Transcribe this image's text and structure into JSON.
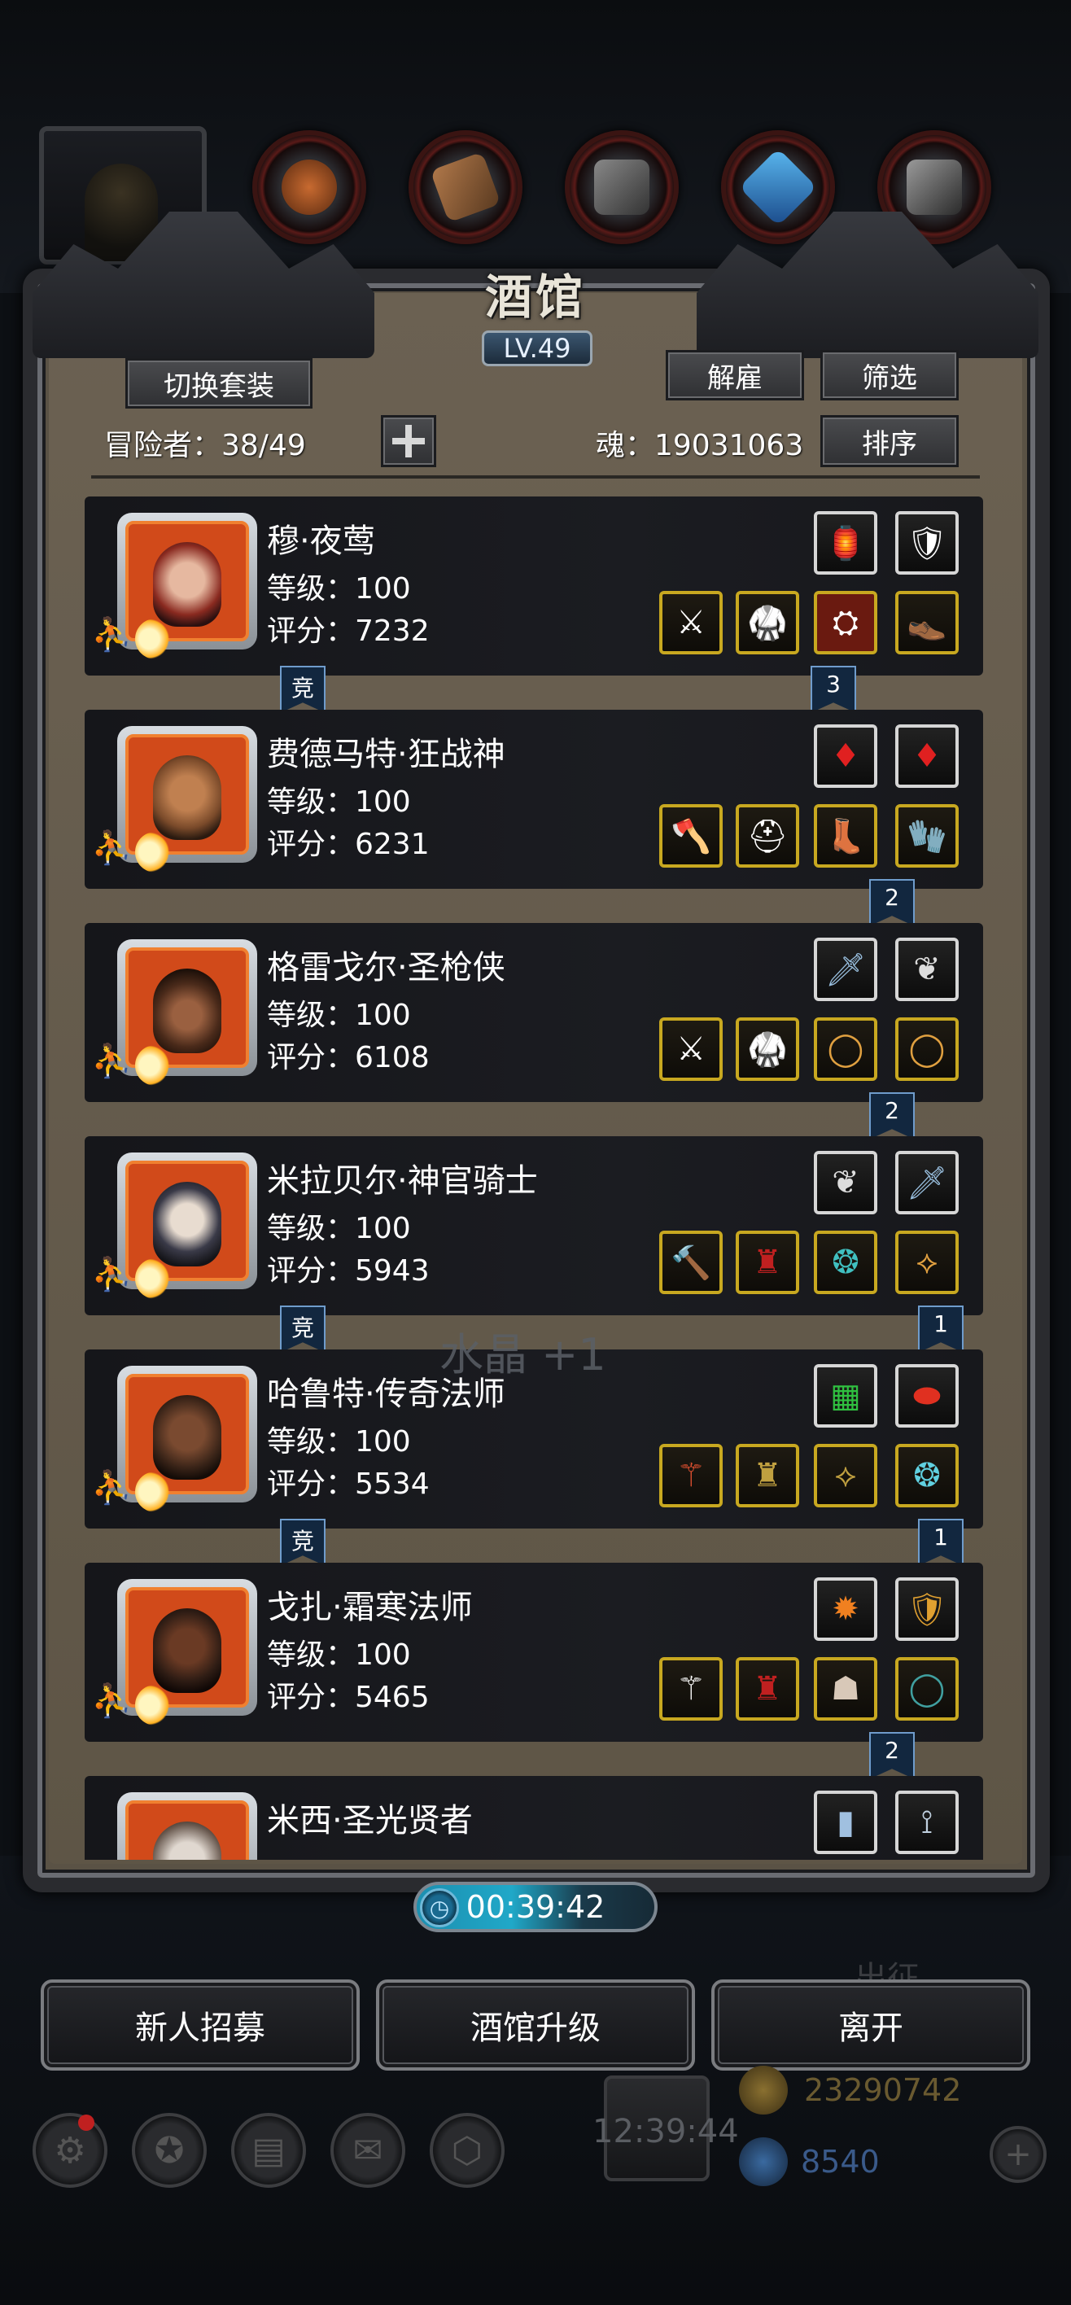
{
  "tavern": {
    "title": "酒馆",
    "level": "LV.49",
    "switch_outfit": "切换套装",
    "dismiss": "解雇",
    "filter": "筛选",
    "sort": "排序",
    "adventurers_label": "冒险者：38/49",
    "soul_label": "魂：19031063"
  },
  "heroes": [
    {
      "name": "穆·夜莺",
      "level": "等级：100",
      "score": "评分：7232",
      "ribbon_left": "竞",
      "ribbon_right": "3",
      "face": "#8a2a20"
    },
    {
      "name": "费德马特·狂战神",
      "level": "等级：100",
      "score": "评分：6231",
      "ribbon_left": "",
      "ribbon_right": "2",
      "face": "#7a4a2a"
    },
    {
      "name": "格雷戈尔·圣枪侠",
      "level": "等级：100",
      "score": "评分：6108",
      "ribbon_left": "",
      "ribbon_right": "2",
      "face": "#4a2a1a"
    },
    {
      "name": "米拉贝尔·神官骑士",
      "level": "等级：100",
      "score": "评分：5943",
      "ribbon_left": "竞",
      "ribbon_right": "1",
      "face": "#c8b8a8"
    },
    {
      "name": "哈鲁特·传奇法师",
      "level": "等级：100",
      "score": "评分：5534",
      "ribbon_left": "竞",
      "ribbon_right": "1",
      "face": "#3a2418"
    },
    {
      "name": "戈扎·霜寒法师",
      "level": "等级：100",
      "score": "评分：5465",
      "ribbon_left": "",
      "ribbon_right": "2",
      "face": "#2e1c14"
    },
    {
      "name": "米西·圣光贤者",
      "level": "",
      "score": "",
      "ribbon_left": "",
      "ribbon_right": "",
      "face": "#e0d8d0"
    }
  ],
  "floating_reward": "水晶 +1",
  "timer": "00:39:42",
  "buttons": {
    "recruit": "新人招募",
    "upgrade": "酒馆升级",
    "leave": "离开"
  },
  "background": {
    "expedition": "出征",
    "gold": "23290742",
    "gems": "8540",
    "clock": "12:39:44"
  },
  "colors": {
    "gold_border": "#c8a820",
    "silver_border": "#d6d6d6",
    "avatar_bg": "#d14a1a",
    "timer_fill": "#20a8c8",
    "ribbon_fill": "#12273f"
  }
}
